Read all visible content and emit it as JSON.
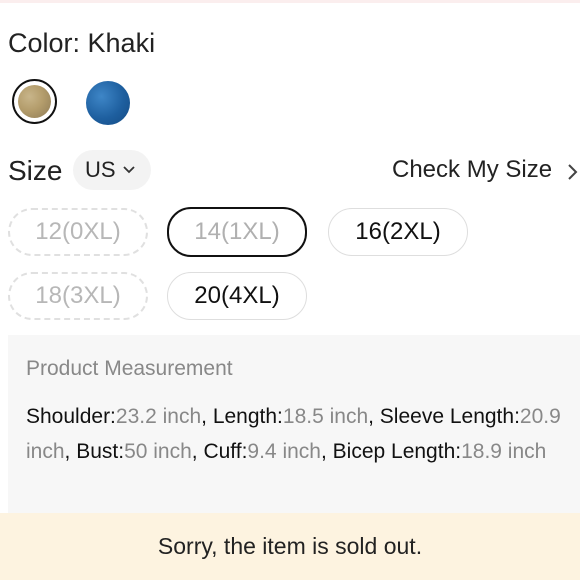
{
  "color": {
    "label": "Color: Khaki",
    "swatches": [
      {
        "name": "Khaki",
        "selected": true,
        "color": "#b49d6c"
      },
      {
        "name": "Blue",
        "selected": false,
        "color": "#1e5f9f"
      }
    ]
  },
  "size": {
    "label": "Size",
    "region": "US",
    "check_link": "Check My Size",
    "options": [
      {
        "label": "12(0XL)",
        "state": "sold-out"
      },
      {
        "label": "14(1XL)",
        "state": "selected-sold-out"
      },
      {
        "label": "16(2XL)",
        "state": "available"
      },
      {
        "label": "18(3XL)",
        "state": "sold-out"
      },
      {
        "label": "20(4XL)",
        "state": "available"
      }
    ]
  },
  "measurement": {
    "title": "Product Measurement",
    "items": [
      {
        "key": "Shoulder:",
        "value": "23.2 inch"
      },
      {
        "key": "Length:",
        "value": "18.5 inch"
      },
      {
        "key": "Sleeve Length:",
        "value": "20.9 inch"
      },
      {
        "key": "Bust:",
        "value": "50 inch"
      },
      {
        "key": "Cuff:",
        "value": "9.4 inch"
      },
      {
        "key": "Bicep Length:",
        "value": "18.9 inch"
      }
    ]
  },
  "notice": "Sorry, the item is sold out.",
  "colors": {
    "notice_bg": "#fdf3e0",
    "panel_bg": "#f7f7f7",
    "muted_text": "#888888"
  }
}
